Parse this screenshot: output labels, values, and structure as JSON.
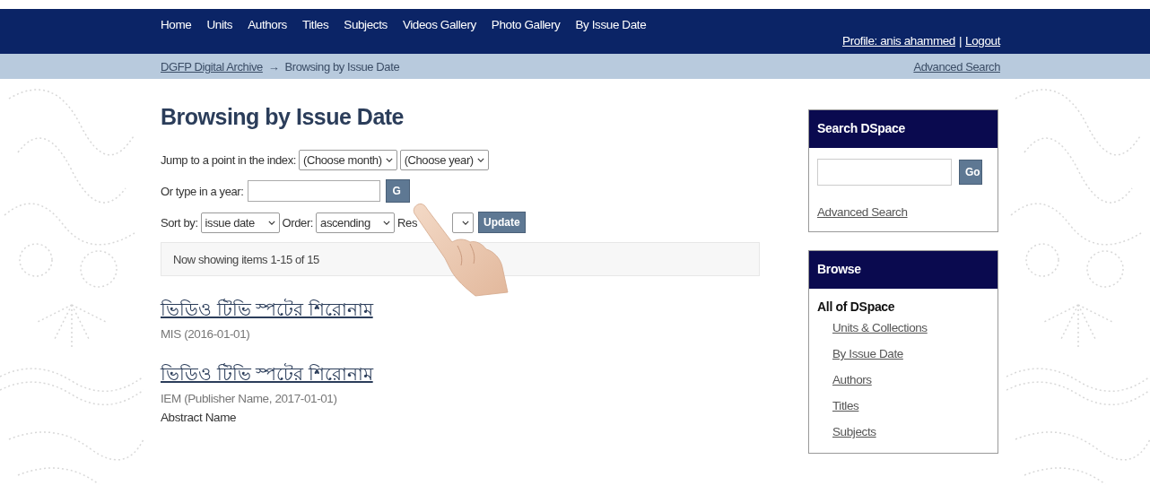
{
  "nav": {
    "items": [
      "Home",
      "Units",
      "Authors",
      "Titles",
      "Subjects",
      "Videos Gallery",
      "Photo Gallery",
      "By Issue Date"
    ],
    "profile": "Profile: anis ahammed",
    "separator": "|",
    "logout": "Logout"
  },
  "breadcrumb": {
    "root": "DGFP Digital Archive",
    "arrow": "→",
    "current": "Browsing by Issue Date",
    "advanced_search": "Advanced Search"
  },
  "main": {
    "heading": "Browsing by Issue Date",
    "jump_label": "Jump to a point in the index:",
    "month_select": "(Choose month)",
    "year_select": "(Choose year)",
    "year_label": "Or type in a year:",
    "year_go": "G",
    "sort_label": "Sort by:",
    "sort_select": "issue date",
    "order_label": "Order:",
    "order_select": "ascending",
    "results_label": "Res",
    "update": "Update",
    "status": "Now showing items 1-15 of 15",
    "items": [
      {
        "title": "ভিডিও টিভি স্পটের শিরোনাম",
        "meta": "MIS (2016-01-01)"
      },
      {
        "title": "ভিডিও টিভি স্পটের শিরোনাম",
        "meta": "IEM (Publisher Name, 2017-01-01)",
        "abstract": "Abstract Name"
      }
    ]
  },
  "sidebar": {
    "search": {
      "title": "Search DSpace",
      "go": "Go",
      "advanced_search": "Advanced Search"
    },
    "browse": {
      "title": "Browse",
      "section": "All of DSpace",
      "links": [
        "Units & Collections",
        "By Issue Date",
        "Authors",
        "Titles",
        "Subjects"
      ]
    }
  }
}
